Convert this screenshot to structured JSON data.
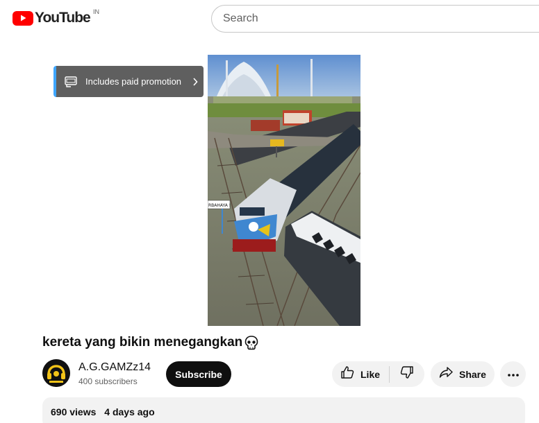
{
  "header": {
    "logo_text": "YouTube",
    "country_code": "IN",
    "search_placeholder": "Search"
  },
  "promo": {
    "label": "Includes paid promotion"
  },
  "video": {
    "title": "kereta yang bikin menegangkan",
    "sign_text": "RBAHAYA !"
  },
  "channel": {
    "name": "A.G.GAMZz14",
    "subscribers": "400 subscribers",
    "subscribe_label": "Subscribe"
  },
  "actions": {
    "like_label": "Like",
    "share_label": "Share"
  },
  "description": {
    "views": "690 views",
    "date": "4 days ago"
  },
  "icons": [
    "youtube-logo-icon",
    "paid-promotion-icon",
    "chevron-right-icon",
    "skull-icon",
    "thumbs-up-icon",
    "thumbs-down-icon",
    "share-icon",
    "more-icon"
  ],
  "colors": {
    "brand_red": "#ff0000",
    "promo_bg": "#5f5f5f",
    "promo_accent": "#3ea6ff",
    "button_dark": "#0f0f0f",
    "button_light": "#f2f2f2"
  }
}
